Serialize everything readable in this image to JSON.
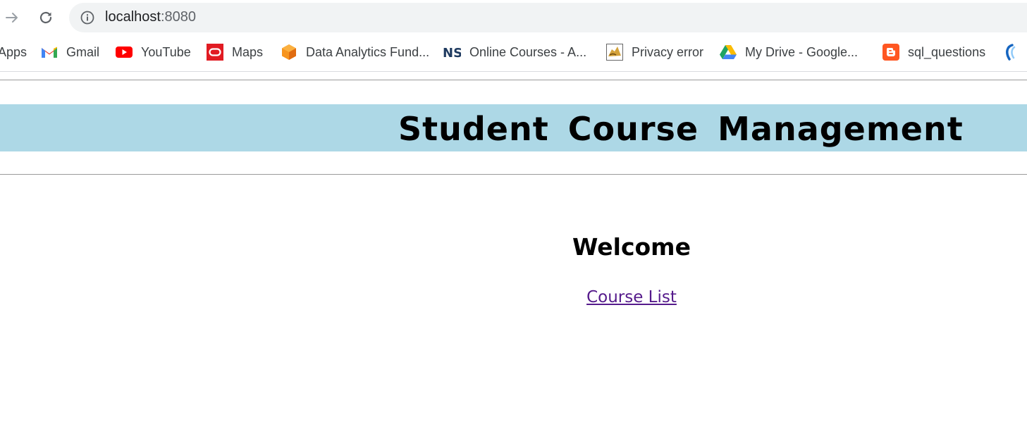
{
  "browser": {
    "url_host": "localhost",
    "url_port": ":8080",
    "bookmarks": [
      {
        "label": "Apps",
        "icon": "apps-icon"
      },
      {
        "label": "Gmail",
        "icon": "gmail-icon"
      },
      {
        "label": "YouTube",
        "icon": "youtube-icon"
      },
      {
        "label": "Maps",
        "icon": "oracle-icon"
      },
      {
        "label": "Data Analytics Fund...",
        "icon": "cube-icon"
      },
      {
        "label": "Online Courses - A...",
        "icon": "ns-icon"
      },
      {
        "label": "Privacy error",
        "icon": "tomcat-icon"
      },
      {
        "label": "My Drive - Google...",
        "icon": "google-drive-icon"
      },
      {
        "label": "sql_questions",
        "icon": "blogger-icon"
      },
      {
        "label": "",
        "icon": "partial-bookmark-icon"
      }
    ]
  },
  "page": {
    "header_title": "Student Course Management",
    "welcome": "Welcome",
    "course_link": "Course List",
    "banner_color": "#add8e6",
    "link_color": "#551a8b"
  }
}
